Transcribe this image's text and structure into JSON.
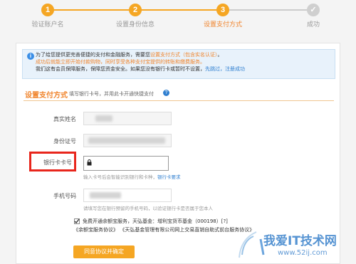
{
  "steps": [
    {
      "num": "1",
      "label": "验证账户名"
    },
    {
      "num": "2",
      "label": "设置身份信息"
    },
    {
      "num": "3",
      "label": "设置支付方式"
    },
    {
      "num": "✓",
      "label": "成功"
    }
  ],
  "notice": {
    "line1_a": "为了给您提供更完善便捷的支付和金融服务，需要您",
    "line1_b": "设置支付方式（包含实名认证）",
    "line1_c": "。",
    "line2": "成功后就能立即开始付款购物，同时享受各种支付宝提供的转账和缴费服务。",
    "line3_a": "我们这有会员保障服务，保障您资金安全。如果您没有银行卡或暂时不设置，",
    "line3_b": "先跳过，注册成功"
  },
  "section": {
    "title": "设置支付方式",
    "subtitle": "填写银行卡号，并用此卡开通快捷支付",
    "help": "?"
  },
  "form": {
    "name_label": "真实姓名",
    "id_label": "身份证号",
    "card_label": "银行卡卡号",
    "card_hint_a": "输入卡号后会智能识别银行和卡种，",
    "card_hint_b": "银行卡要求",
    "phone_label": "手机号码",
    "phone_hint": "请填写您在银行预留的手机号码，以验证银行卡是否属于您本人"
  },
  "agree": {
    "line1": "免费开通余额宝服务，天弘基金：增利宝货币基金（000198）[?]",
    "line2": "《余额宝服务协议》 《天弘基金管理有限公司网上交易直销自助式前台服务协议》"
  },
  "confirm_label": "同意协议并确定",
  "watermark": {
    "brand": "我爱IT技术网",
    "url": "www.52ij.com"
  },
  "colors": {
    "accent": "#f5a623",
    "link": "#2f7fd0",
    "highlight": "#e8261c"
  }
}
